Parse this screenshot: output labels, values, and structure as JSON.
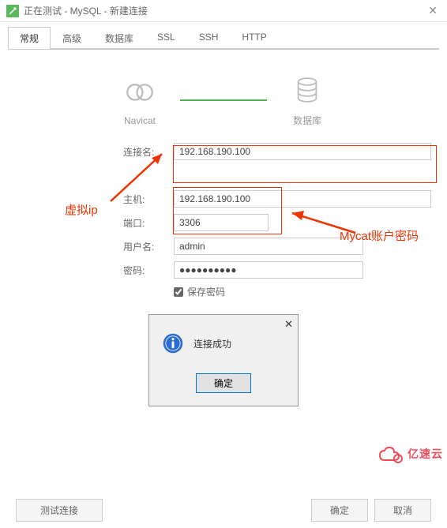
{
  "titlebar": {
    "title": "正在测试 - MySQL - 新建连接"
  },
  "tabs": [
    "常规",
    "高级",
    "数据库",
    "SSL",
    "SSH",
    "HTTP"
  ],
  "activeTab": 0,
  "diagram": {
    "left": "Navicat",
    "right": "数据库"
  },
  "form": {
    "connNameLabel": "连接名:",
    "connName": "192.168.190.100",
    "hostLabel": "主机:",
    "host": "192.168.190.100",
    "portLabel": "端口:",
    "port": "3306",
    "userLabel": "用户名:",
    "user": "admin",
    "passLabel": "密码:",
    "pass": "●●●●●●●●●●",
    "savePassLabel": "保存密码",
    "savePass": true
  },
  "annotations": {
    "virtualIp": "虚拟ip",
    "mycatAcct": "Mycat账户密码"
  },
  "msgbox": {
    "text": "连接成功",
    "ok": "确定"
  },
  "footer": {
    "test": "测试连接",
    "ok": "确定",
    "cancel": "取消"
  },
  "watermark": "亿速云"
}
